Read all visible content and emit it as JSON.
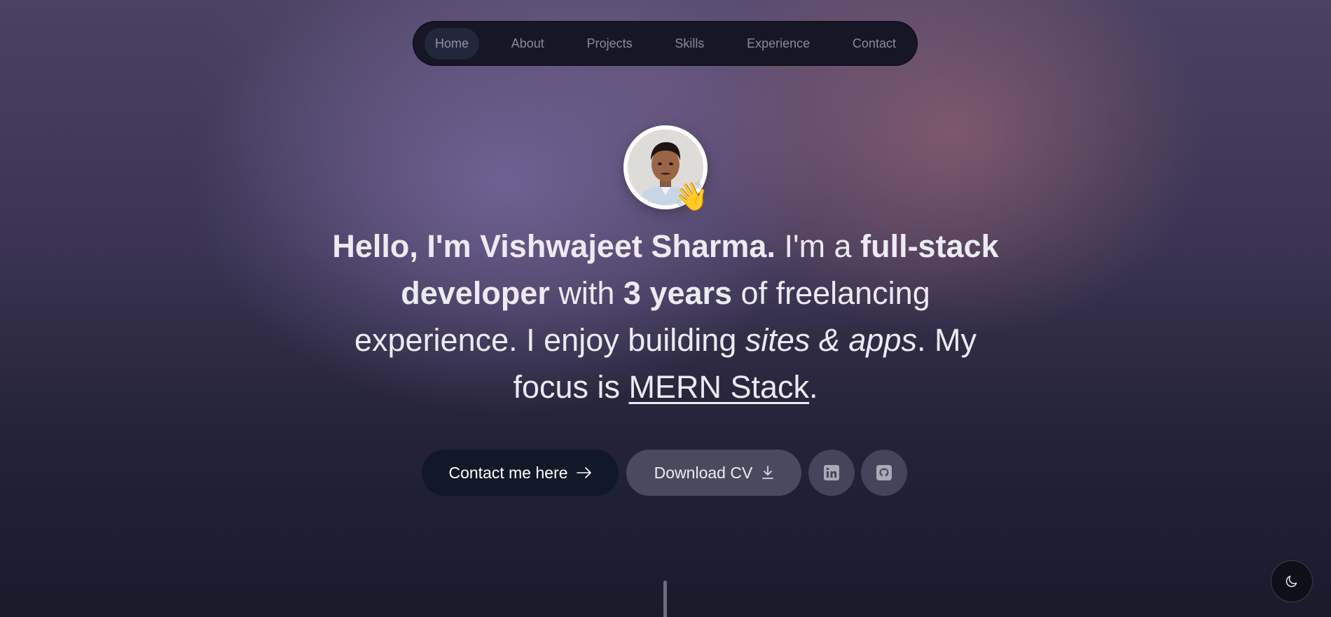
{
  "nav": {
    "items": [
      {
        "label": "Home",
        "active": true
      },
      {
        "label": "About"
      },
      {
        "label": "Projects"
      },
      {
        "label": "Skills"
      },
      {
        "label": "Experience"
      },
      {
        "label": "Contact"
      }
    ]
  },
  "hero": {
    "avatar_icon": "profile-photo",
    "wave_emoji": "👋",
    "headline": {
      "name_intro": "Hello, I'm Vishwajeet Sharma.",
      "im_a": " I'm a ",
      "role": "full-stack developer",
      "with": " with ",
      "years": "3 years",
      "of_freelancing": " of freelancing experience. I enjoy building ",
      "sites_apps": "sites & apps",
      "my_focus": ". My focus is ",
      "stack": "MERN Stack",
      "end": "."
    }
  },
  "actions": {
    "contact_label": "Contact me here",
    "contact_icon": "arrow-right-icon",
    "cv_label": "Download CV",
    "cv_icon": "download-icon",
    "linkedin_icon": "linkedin-icon",
    "github_icon": "github-icon"
  },
  "theme_toggle": {
    "icon": "moon-icon"
  },
  "colors": {
    "primary_button": "#111827",
    "secondary_button": "#4a4a5e",
    "nav_background": "#161625"
  }
}
